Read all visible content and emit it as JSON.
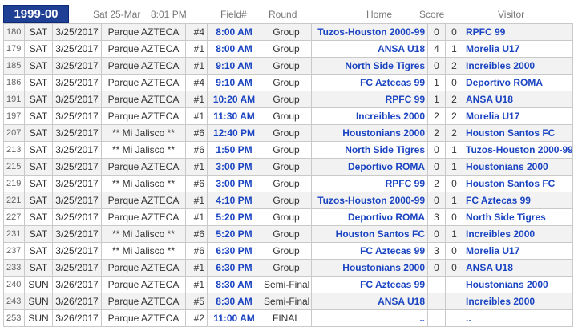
{
  "header": {
    "season": "1999-00",
    "date": "Sat 25-Mar",
    "time": "8:01 PM",
    "col_field": "Field#",
    "col_round": "Round",
    "col_home": "Home",
    "col_score": "Score",
    "col_visitor": "Visitor"
  },
  "games": [
    {
      "id": "180",
      "day": "SAT",
      "date": "3/25/2017",
      "venue": "Parque AZTECA",
      "field": "#4",
      "time": "8:00 AM",
      "round": "Group",
      "home": "Tuzos-Houston 2000-99",
      "hs": "0",
      "vs": "0",
      "visitor": "RPFC 99"
    },
    {
      "id": "179",
      "day": "SAT",
      "date": "3/25/2017",
      "venue": "Parque AZTECA",
      "field": "#1",
      "time": "8:00 AM",
      "round": "Group",
      "home": "ANSA U18",
      "hs": "4",
      "vs": "1",
      "visitor": "Morelia U17"
    },
    {
      "id": "185",
      "day": "SAT",
      "date": "3/25/2017",
      "venue": "Parque AZTECA",
      "field": "#1",
      "time": "9:10 AM",
      "round": "Group",
      "home": "North Side Tigres",
      "hs": "0",
      "vs": "2",
      "visitor": "Increibles 2000"
    },
    {
      "id": "186",
      "day": "SAT",
      "date": "3/25/2017",
      "venue": "Parque AZTECA",
      "field": "#4",
      "time": "9:10 AM",
      "round": "Group",
      "home": "FC Aztecas 99",
      "hs": "1",
      "vs": "0",
      "visitor": "Deportivo ROMA"
    },
    {
      "id": "191",
      "day": "SAT",
      "date": "3/25/2017",
      "venue": "Parque AZTECA",
      "field": "#1",
      "time": "10:20 AM",
      "round": "Group",
      "home": "RPFC 99",
      "hs": "1",
      "vs": "2",
      "visitor": "ANSA U18"
    },
    {
      "id": "197",
      "day": "SAT",
      "date": "3/25/2017",
      "venue": "Parque AZTECA",
      "field": "#1",
      "time": "11:30 AM",
      "round": "Group",
      "home": "Increibles 2000",
      "hs": "2",
      "vs": "2",
      "visitor": "Morelia U17"
    },
    {
      "id": "207",
      "day": "SAT",
      "date": "3/25/2017",
      "venue": "** Mi Jalisco **",
      "field": "#6",
      "time": "12:40 PM",
      "round": "Group",
      "home": "Houstonians 2000",
      "hs": "2",
      "vs": "2",
      "visitor": "Houston Santos FC"
    },
    {
      "id": "213",
      "day": "SAT",
      "date": "3/25/2017",
      "venue": "** Mi Jalisco **",
      "field": "#6",
      "time": "1:50 PM",
      "round": "Group",
      "home": "North Side Tigres",
      "hs": "0",
      "vs": "1",
      "visitor": "Tuzos-Houston 2000-99"
    },
    {
      "id": "215",
      "day": "SAT",
      "date": "3/25/2017",
      "venue": "Parque AZTECA",
      "field": "#1",
      "time": "3:00 PM",
      "round": "Group",
      "home": "Deportivo ROMA",
      "hs": "0",
      "vs": "1",
      "visitor": "Houstonians 2000"
    },
    {
      "id": "219",
      "day": "SAT",
      "date": "3/25/2017",
      "venue": "** Mi Jalisco **",
      "field": "#6",
      "time": "3:00 PM",
      "round": "Group",
      "home": "RPFC 99",
      "hs": "2",
      "vs": "0",
      "visitor": "Houston Santos FC"
    },
    {
      "id": "221",
      "day": "SAT",
      "date": "3/25/2017",
      "venue": "Parque AZTECA",
      "field": "#1",
      "time": "4:10 PM",
      "round": "Group",
      "home": "Tuzos-Houston 2000-99",
      "hs": "0",
      "vs": "1",
      "visitor": "FC Aztecas 99"
    },
    {
      "id": "227",
      "day": "SAT",
      "date": "3/25/2017",
      "venue": "Parque AZTECA",
      "field": "#1",
      "time": "5:20 PM",
      "round": "Group",
      "home": "Deportivo ROMA",
      "hs": "3",
      "vs": "0",
      "visitor": "North Side Tigres"
    },
    {
      "id": "231",
      "day": "SAT",
      "date": "3/25/2017",
      "venue": "** Mi Jalisco **",
      "field": "#6",
      "time": "5:20 PM",
      "round": "Group",
      "home": "Houston Santos FC",
      "hs": "0",
      "vs": "1",
      "visitor": "Increibles 2000"
    },
    {
      "id": "237",
      "day": "SAT",
      "date": "3/25/2017",
      "venue": "** Mi Jalisco **",
      "field": "#6",
      "time": "6:30 PM",
      "round": "Group",
      "home": "FC Aztecas 99",
      "hs": "3",
      "vs": "0",
      "visitor": "Morelia U17"
    },
    {
      "id": "233",
      "day": "SAT",
      "date": "3/25/2017",
      "venue": "Parque AZTECA",
      "field": "#1",
      "time": "6:30 PM",
      "round": "Group",
      "home": "Houstonians 2000",
      "hs": "0",
      "vs": "0",
      "visitor": "ANSA U18"
    },
    {
      "id": "240",
      "day": "SUN",
      "date": "3/26/2017",
      "venue": "Parque AZTECA",
      "field": "#1",
      "time": "8:30 AM",
      "round": "Semi-Final",
      "home": "FC Aztecas 99",
      "hs": "",
      "vs": "",
      "visitor": "Houstonians 2000"
    },
    {
      "id": "243",
      "day": "SUN",
      "date": "3/26/2017",
      "venue": "Parque AZTECA",
      "field": "#5",
      "time": "8:30 AM",
      "round": "Semi-Final",
      "home": "ANSA U18",
      "hs": "",
      "vs": "",
      "visitor": "Increibles 2000"
    },
    {
      "id": "253",
      "day": "SUN",
      "date": "3/26/2017",
      "venue": "Parque AZTECA",
      "field": "#2",
      "time": "11:00 AM",
      "round": "FINAL",
      "home": "..",
      "hs": "",
      "vs": "",
      "visitor": ".."
    }
  ]
}
